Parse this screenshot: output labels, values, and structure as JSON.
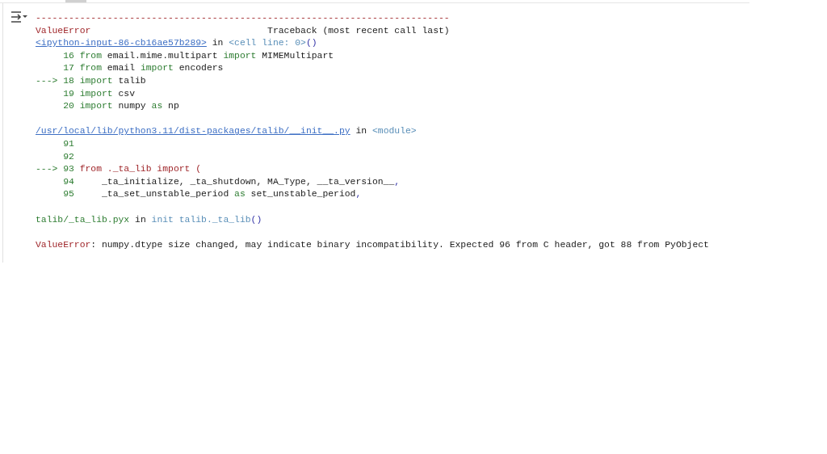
{
  "output": {
    "blocks": [
      {
        "lines": [
          {
            "segments": [
              {
                "kind": "error",
                "t": "---------------------------------------------------------------------------"
              }
            ]
          },
          {
            "segments": [
              {
                "kind": "error",
                "t": "ValueError"
              },
              {
                "kind": "plain",
                "t": "                                Traceback (most recent call last)"
              }
            ]
          },
          {
            "segments": [
              {
                "kind": "link",
                "t": "<ipython-input-86-cb16ae57b289>"
              },
              {
                "kind": "plain",
                "t": " in "
              },
              {
                "kind": "cell",
                "t": "<cell line: 0>"
              },
              {
                "kind": "paren",
                "t": "()"
              }
            ]
          },
          {
            "lineno": "16",
            "segments": [
              {
                "kind": "keyword",
                "t": "from"
              },
              {
                "kind": "plain",
                "t": " email.mime.multipart "
              },
              {
                "kind": "keyword",
                "t": "import"
              },
              {
                "kind": "plain",
                "t": " MIMEMultipart"
              }
            ]
          },
          {
            "lineno": "17",
            "segments": [
              {
                "kind": "keyword",
                "t": "from"
              },
              {
                "kind": "plain",
                "t": " email "
              },
              {
                "kind": "keyword",
                "t": "import"
              },
              {
                "kind": "plain",
                "t": " encoders"
              }
            ]
          },
          {
            "marker": "--->",
            "lineno": "18",
            "segments": [
              {
                "kind": "keyword",
                "t": "import"
              },
              {
                "kind": "plain",
                "t": " talib"
              }
            ]
          },
          {
            "lineno": "19",
            "segments": [
              {
                "kind": "keyword",
                "t": "import"
              },
              {
                "kind": "plain",
                "t": " csv"
              }
            ]
          },
          {
            "lineno": "20",
            "segments": [
              {
                "kind": "keyword",
                "t": "import"
              },
              {
                "kind": "plain",
                "t": " numpy "
              },
              {
                "kind": "keyword",
                "t": "as"
              },
              {
                "kind": "plain",
                "t": " np"
              }
            ]
          }
        ]
      },
      {
        "lines": [
          {
            "segments": [
              {
                "kind": "link",
                "t": "/usr/local/lib/python3.11/dist-packages/talib/__init__.py"
              },
              {
                "kind": "plain",
                "t": " in "
              },
              {
                "kind": "cell",
                "t": "<module>"
              }
            ]
          },
          {
            "lineno": "91"
          },
          {
            "lineno": "92"
          },
          {
            "marker": "--->",
            "lineno": "93",
            "segments": [
              {
                "kind": "error",
                "t": "from ._ta_lib import ("
              }
            ]
          },
          {
            "lineno": "94",
            "segments": [
              {
                "kind": "plain",
                "t": "    _ta_initialize, _ta_shutdown, MA_Type, __ta_version__"
              },
              {
                "kind": "paren",
                "t": ","
              }
            ]
          },
          {
            "lineno": "95",
            "segments": [
              {
                "kind": "plain",
                "t": "    _ta_set_unstable_period "
              },
              {
                "kind": "keyword",
                "t": "as"
              },
              {
                "kind": "plain",
                "t": " set_unstable_period"
              },
              {
                "kind": "paren",
                "t": ","
              }
            ]
          }
        ]
      },
      {
        "lines": [
          {
            "segments": [
              {
                "kind": "lineno",
                "t": "talib/_ta_lib.pyx"
              },
              {
                "kind": "plain",
                "t": " in "
              },
              {
                "kind": "cell",
                "t": "init talib._ta_lib"
              },
              {
                "kind": "paren",
                "t": "()"
              }
            ]
          }
        ]
      },
      {
        "lines": [
          {
            "segments": [
              {
                "kind": "error",
                "t": "ValueError"
              },
              {
                "kind": "plain",
                "t": ": numpy.dtype size changed, may indicate binary incompatibility. Expected 96 from C header, got 88 from PyObject"
              }
            ]
          }
        ]
      }
    ]
  }
}
